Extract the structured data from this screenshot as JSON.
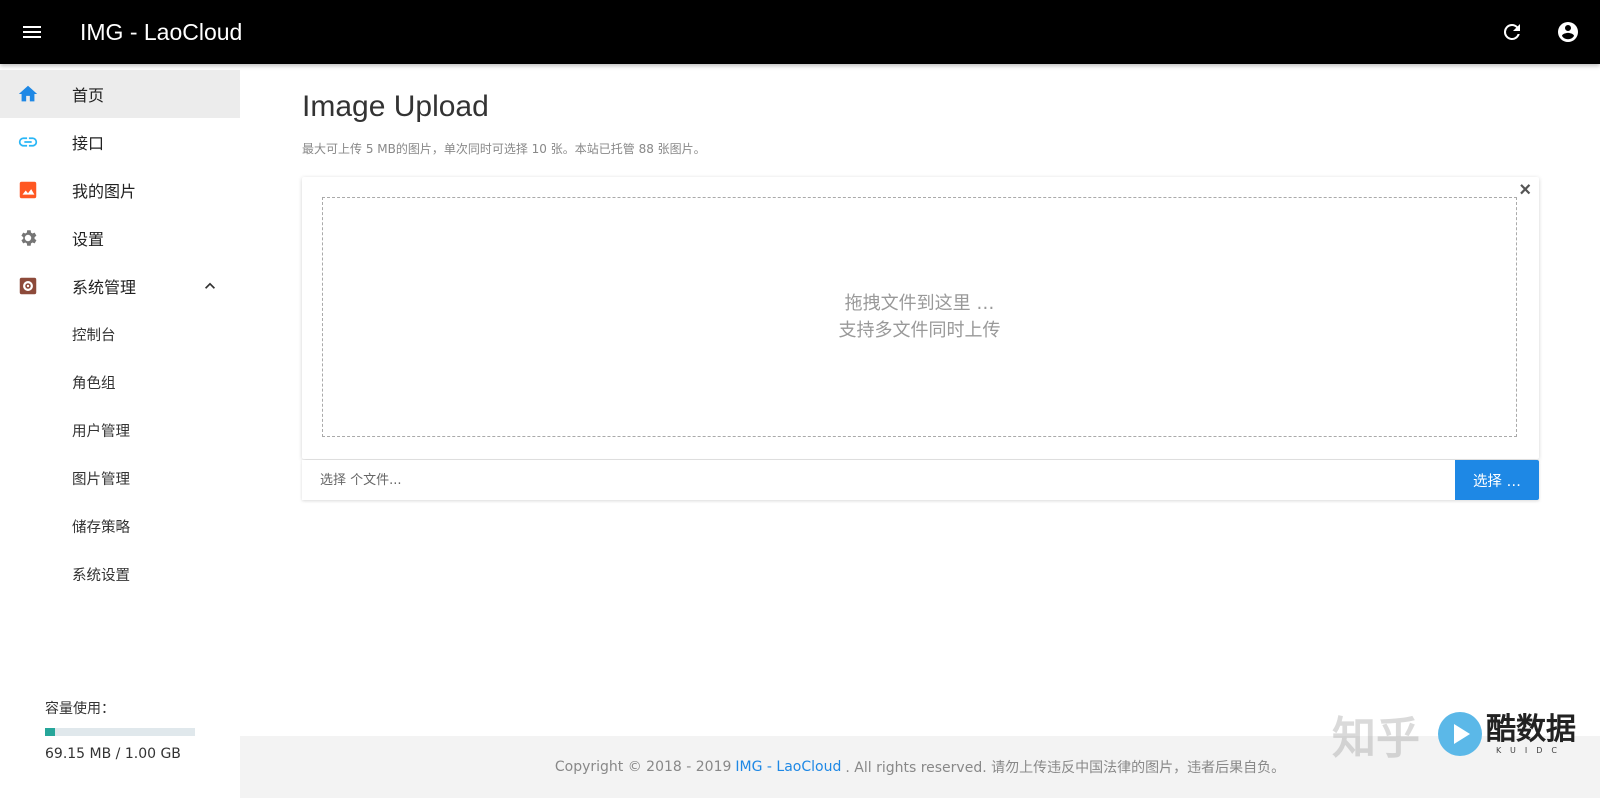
{
  "header": {
    "title": "IMG - LaoCloud",
    "menu_icon": "menu-icon",
    "refresh_icon": "refresh-icon",
    "account_icon": "account-circle-icon",
    "background": "#000000"
  },
  "sidebar": {
    "items": [
      {
        "label": "首页",
        "icon": "home-icon",
        "color": "#1e88e5",
        "active": true
      },
      {
        "label": "接口",
        "icon": "link-icon",
        "color": "#29b6f6"
      },
      {
        "label": "我的图片",
        "icon": "image-icon",
        "color": "#ff5722"
      },
      {
        "label": "设置",
        "icon": "gear-icon",
        "color": "#757575"
      },
      {
        "label": "系统管理",
        "icon": "admin-gear-icon",
        "color": "#8d4a3a",
        "expanded": true
      }
    ],
    "sub_items": [
      "控制台",
      "角色组",
      "用户管理",
      "图片管理",
      "储存策略",
      "系统设置"
    ],
    "storage": {
      "label": "容量使用：",
      "used_text": "69.15 MB / 1.00 GB",
      "fraction": 0.0675,
      "color": "#26a69a"
    }
  },
  "main": {
    "title": "Image Upload",
    "subtitle": "最大可上传 5 MB的图片，单次同时可选择 10 张。本站已托管 88 张图片。",
    "dropzone": {
      "line1": "拖拽文件到这里 …",
      "line2": "支持多文件同时上传",
      "close": "×"
    },
    "file_input_placeholder": "选择 个文件...",
    "pick_button": "选择 …",
    "accent": "#1e88e5"
  },
  "footer": {
    "prefix": "Copyright © 2018 - 2019",
    "link": "IMG - LaoCloud",
    "suffix": ". All rights reserved. 请勿上传违反中国法律的图片，违者后果自负。"
  },
  "watermark": {
    "zhihu": "知乎",
    "brand": "酷数据",
    "brand_small": "KUIDC"
  }
}
